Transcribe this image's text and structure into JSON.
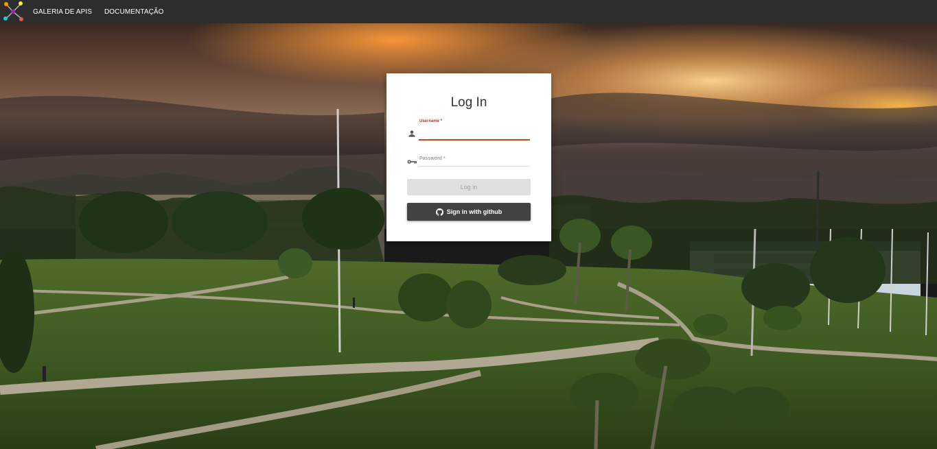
{
  "nav": {
    "logo_icon": "network-nodes-logo",
    "links": [
      "GALERIA DE APIS",
      "DOCUMENTAÇÃO"
    ]
  },
  "login": {
    "title": "Log In",
    "username": {
      "label": "Username *",
      "icon": "person-icon",
      "value": ""
    },
    "password": {
      "label": "Password *",
      "icon": "key-icon",
      "value": ""
    },
    "login_button": "Log in",
    "github_button": "Sign in with github",
    "github_icon": "github-icon"
  },
  "colors": {
    "topbar": "#2d2d2d",
    "required_label": "#c62828",
    "active_underline": "#c24a1a",
    "github_button": "#424242",
    "login_button_disabled": "#e0e0e0"
  }
}
